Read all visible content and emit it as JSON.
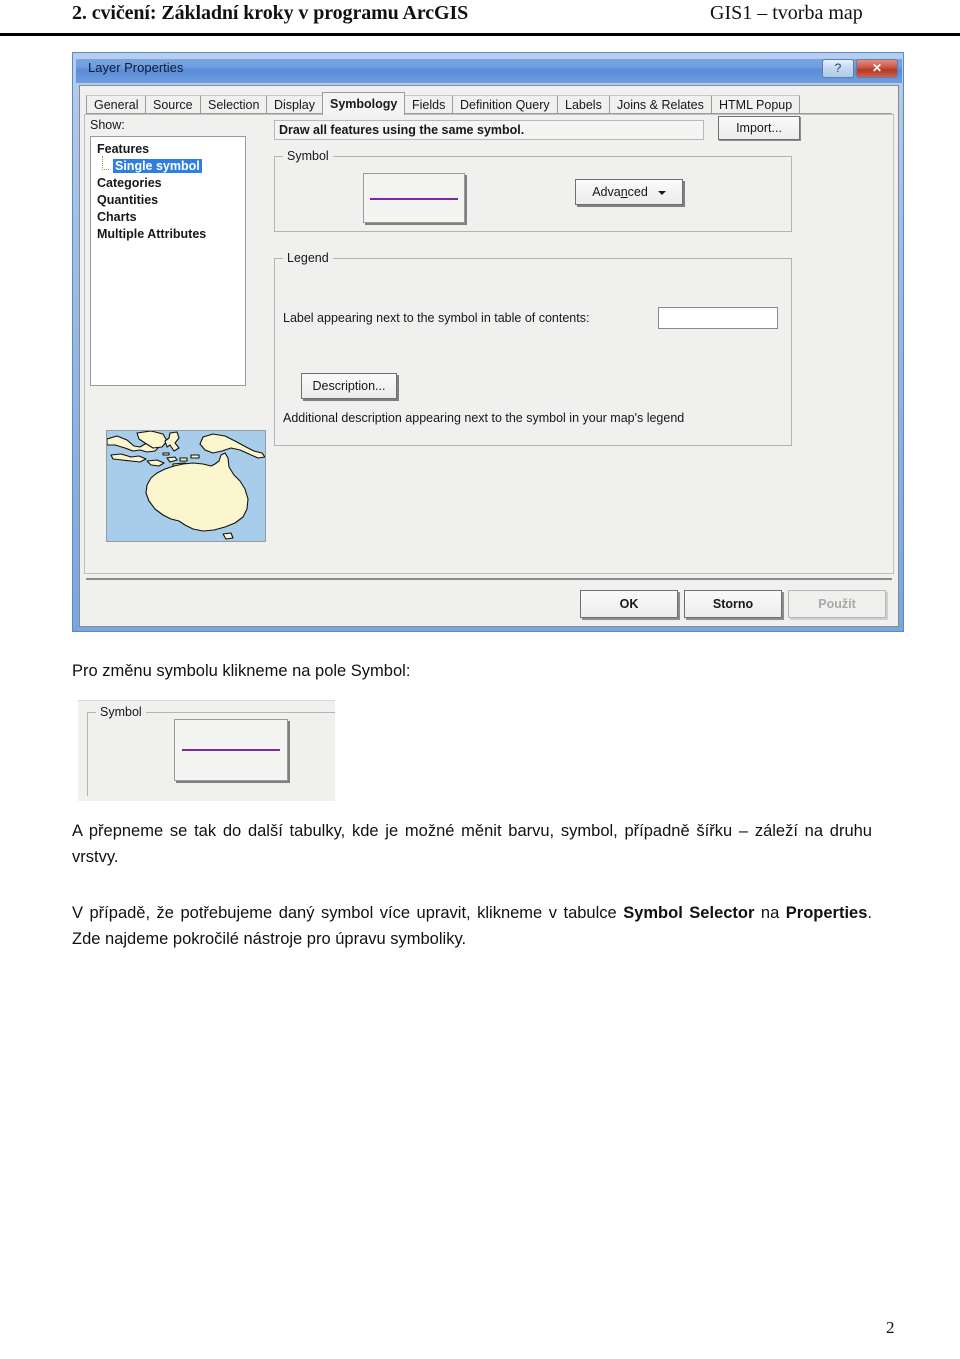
{
  "document_header": {
    "left_title": "2. cvičení: Základní kroky v programu ArcGIS",
    "right_title": "GIS1 – tvorba map"
  },
  "dialog": {
    "title": "Layer Properties",
    "titlebar_buttons": {
      "help": "?",
      "close": "✕"
    },
    "tabs": [
      {
        "label": "General",
        "selected": false
      },
      {
        "label": "Source",
        "selected": false
      },
      {
        "label": "Selection",
        "selected": false
      },
      {
        "label": "Display",
        "selected": false
      },
      {
        "label": "Symbology",
        "selected": true
      },
      {
        "label": "Fields",
        "selected": false
      },
      {
        "label": "Definition Query",
        "selected": false
      },
      {
        "label": "Labels",
        "selected": false
      },
      {
        "label": "Joins & Relates",
        "selected": false
      },
      {
        "label": "HTML Popup",
        "selected": false
      }
    ],
    "show": {
      "label": "Show:",
      "items": [
        {
          "label": "Features",
          "child": false,
          "selected": false
        },
        {
          "label": "Single symbol",
          "child": true,
          "selected": true
        },
        {
          "label": "Categories",
          "child": false,
          "selected": false
        },
        {
          "label": "Quantities",
          "child": false,
          "selected": false
        },
        {
          "label": "Charts",
          "child": false,
          "selected": false
        },
        {
          "label": "Multiple Attributes",
          "child": false,
          "selected": false
        }
      ]
    },
    "draw_description": "Draw all features using the same symbol.",
    "import_button": "Import...",
    "symbol_group": {
      "title": "Symbol",
      "swatch_color": "#7b2a9e",
      "advanced_button": {
        "prefix": "Adva",
        "accel": "n",
        "suffix": "ced"
      }
    },
    "legend_group": {
      "title": "Legend",
      "label_caption": "Label appearing next to the symbol in table of contents:",
      "label_value": "",
      "label_placeholder": "",
      "description_button": "Description...",
      "additional_description": "Additional description appearing next to the symbol in your map's legend"
    },
    "buttons": {
      "ok": "OK",
      "cancel": "Storno",
      "apply": "Použít",
      "apply_disabled": true
    },
    "map_preview": {
      "ocean_color": "#a8cdea",
      "land_color": "#fbf6ce",
      "outline_color": "#111111"
    }
  },
  "body": {
    "p1": "Pro změnu symbolu klikneme na pole Symbol:",
    "crop_symbol_title": "Symbol",
    "crop_symbol_color": "#7b2a9e",
    "p2": "A přepneme se tak do další tabulky, kde je možné měnit barvu, symbol, případně šířku – záleží na druhu vrstvy.",
    "p3_part1": "V případě, že potřebujeme daný symbol více upravit, klikneme v tabulce ",
    "p3_bold1": "Symbol Selector",
    "p3_part2": " na ",
    "p3_bold2": "Properties",
    "p3_part3": ". Zde najdeme pokročilé nástroje pro úpravu symboliky."
  },
  "page_number": "2"
}
